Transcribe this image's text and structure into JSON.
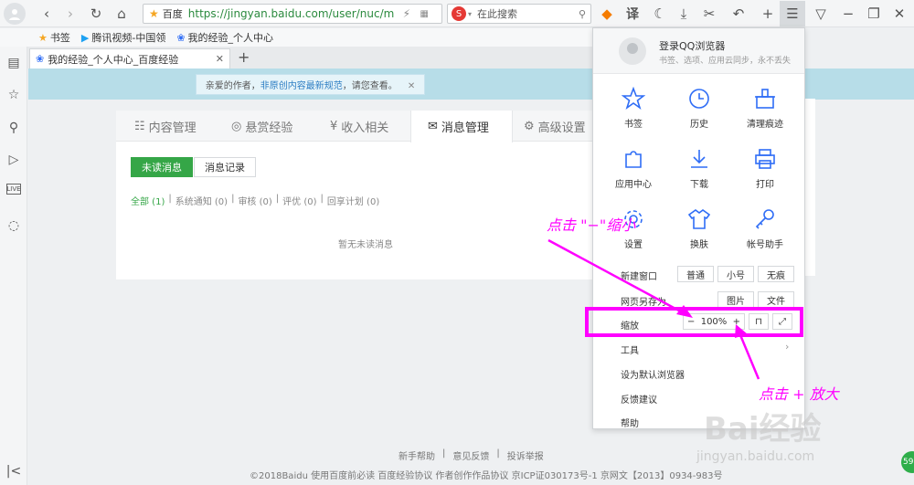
{
  "browser": {
    "address": {
      "site_label": "百度",
      "url": "https://jingyan.baidu.com/user/nuc/m"
    },
    "search": {
      "placeholder": "在此搜索"
    },
    "translate_label": "译",
    "bookmarks": [
      {
        "label": "书签"
      },
      {
        "label": "腾讯视频-中国领"
      },
      {
        "label": "我的经验_个人中心"
      }
    ],
    "tab": {
      "title": "我的经验_个人中心_百度经验"
    },
    "sidebar_live_label": "LIVE"
  },
  "page": {
    "notice": {
      "prefix": "亲爱的作者，",
      "link": "非原创内容最新规范",
      "suffix": "，请您查看。"
    },
    "tabs": [
      {
        "label": "内容管理"
      },
      {
        "label": "悬赏经验"
      },
      {
        "label": "收入相关"
      },
      {
        "label": "消息管理"
      },
      {
        "label": "高级设置"
      }
    ],
    "buttons": {
      "unread": "未读消息",
      "record": "消息记录"
    },
    "filters": [
      {
        "label": "全部 (1)"
      },
      {
        "label": "系统通知 (0)"
      },
      {
        "label": "审核 (0)"
      },
      {
        "label": "评优 (0)"
      },
      {
        "label": "回享计划 (0)"
      }
    ],
    "empty_text": "暂无未读消息",
    "footer_links": [
      "新手帮助",
      "意见反馈",
      "投诉举报"
    ],
    "footer_copyright": "©2018Baidu  使用百度前必读  百度经验协议  作者创作作品协议  京ICP证030173号-1 京网文【2013】0934-983号"
  },
  "menu": {
    "login_title": "登录QQ浏览器",
    "login_sub": "书签、选项、应用云同步，永不丢失",
    "grid": [
      {
        "label": "书签",
        "icon": "star-icon"
      },
      {
        "label": "历史",
        "icon": "clock-icon"
      },
      {
        "label": "清理痕迹",
        "icon": "broom-icon"
      },
      {
        "label": "应用中心",
        "icon": "puzzle-icon"
      },
      {
        "label": "下载",
        "icon": "download-icon"
      },
      {
        "label": "打印",
        "icon": "printer-icon"
      },
      {
        "label": "设置",
        "icon": "gear-icon"
      },
      {
        "label": "换肤",
        "icon": "shirt-icon"
      },
      {
        "label": "帐号助手",
        "icon": "key-icon"
      }
    ],
    "new_window": {
      "label": "新建窗口",
      "options": [
        "普通",
        "小号",
        "无痕"
      ]
    },
    "save_as": {
      "label": "网页另存为",
      "options": [
        "图片",
        "文件"
      ]
    },
    "zoom": {
      "label": "缩放",
      "minus": "−",
      "value": "100%",
      "plus": "+"
    },
    "items": [
      "工具",
      "设为默认浏览器",
      "反馈建议",
      "帮助"
    ]
  },
  "annotations": {
    "zoom_out": "点击 \"−\"缩小",
    "zoom_in": "点击 + 放大"
  },
  "watermark": {
    "logo": "Bai经验",
    "url": "jingyan.baidu.com"
  },
  "badge": "59",
  "colors": {
    "accent_green": "#35a647",
    "annotation": "#ff00ff",
    "link_blue": "#2d7ec4",
    "icon_blue": "#2f6df6"
  }
}
